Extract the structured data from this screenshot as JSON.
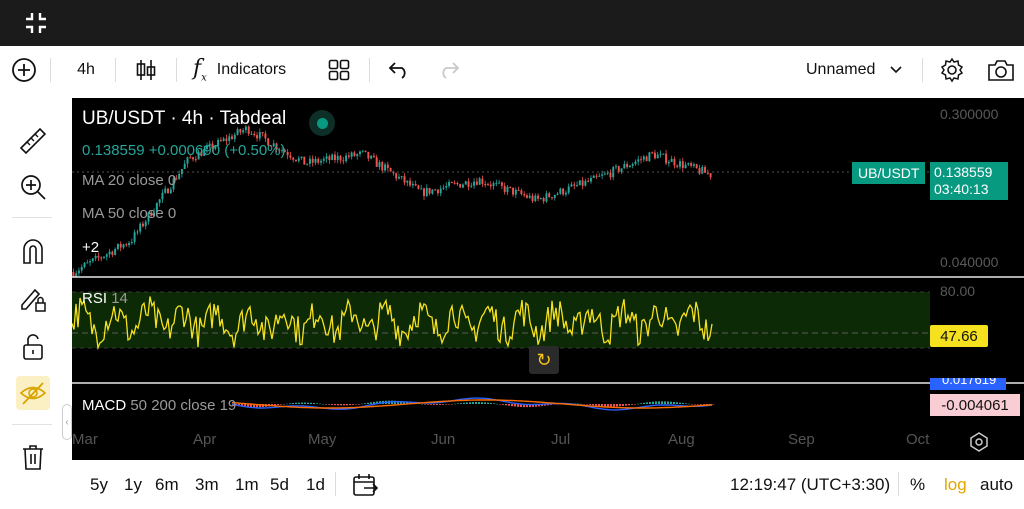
{
  "toolbar": {
    "interval": "4h",
    "indicators_label": "Indicators",
    "layout_name": "Unnamed"
  },
  "chart": {
    "title": "UB/USDT · 4h · Tabdeal",
    "status_color": "#089981",
    "price_line": "0.138559  +0.000690 (+0.50%)",
    "ma20": "MA 20 close 0",
    "ma50": "MA 50 close 0",
    "more_count": "+2",
    "price_axis_top": "0.300000",
    "price_axis_bottom": "0.040000",
    "symbol_badge": "UB/USDT",
    "last_price": "0.138559",
    "countdown": "03:40:13",
    "rsi_label": "RSI",
    "rsi_length": "14",
    "rsi_upper": "80.00",
    "rsi_value": "47.66",
    "macd_label": "MACD",
    "macd_params": "50 200 close 19",
    "macd_value_top": "0.017619",
    "macd_value": "-0.004061",
    "months": [
      "Mar",
      "Apr",
      "May",
      "Jun",
      "Jul",
      "Aug",
      "Sep",
      "Oct"
    ],
    "colors": {
      "up": "#26a69a",
      "down": "#ef5350",
      "rsi": "#f5e11e",
      "macd": "#2962ff",
      "signal": "#ff6d00"
    }
  },
  "chart_data": {
    "type": "candlestick",
    "title": "UB/USDT · 4h · Tabdeal",
    "x_range": [
      "Mar",
      "Oct"
    ],
    "y_scale": "log",
    "ylim": [
      0.04,
      0.3
    ],
    "close_trend": [
      0.04,
      0.06,
      0.17,
      0.25,
      0.16,
      0.18,
      0.11,
      0.13,
      0.1,
      0.13,
      0.18,
      0.138559
    ],
    "rsi": {
      "length": 14,
      "upper": 80,
      "last": 47.66
    },
    "macd": {
      "fast": 50,
      "slow": 200,
      "signal": 19,
      "last": -0.004061
    }
  },
  "bottombar": {
    "ranges": [
      "5y",
      "1y",
      "6m",
      "3m",
      "1m",
      "5d",
      "1d"
    ],
    "time": "12:19:47 (UTC+3:30)",
    "percent": "%",
    "log": "log",
    "auto": "auto"
  }
}
